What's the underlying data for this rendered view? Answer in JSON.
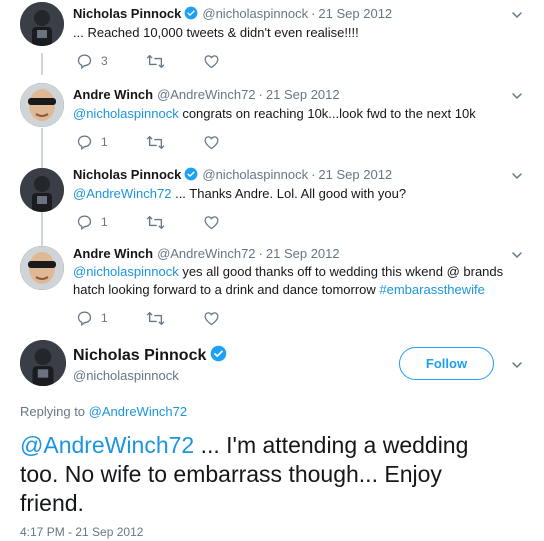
{
  "tweets": [
    {
      "name": "Nicholas Pinnock",
      "handle": "@nicholaspinnock",
      "date": "21 Sep 2012",
      "text": "... Reached 10,000 tweets & didn't even realise!!!!",
      "reply_count": "3",
      "retweet_count": "",
      "verified": true
    },
    {
      "name": "Andre Winch",
      "handle": "@AndreWinch72",
      "date": "21 Sep 2012",
      "mention": "@nicholaspinnock",
      "text": " congrats on reaching 10k...look fwd to the next 10k",
      "reply_count": "1",
      "verified": false
    },
    {
      "name": "Nicholas Pinnock",
      "handle": "@nicholaspinnock",
      "date": "21 Sep 2012",
      "mention": "@AndreWinch72",
      "text": " ... Thanks Andre. Lol. All good with you?",
      "reply_count": "1",
      "verified": true
    },
    {
      "name": "Andre Winch",
      "handle": "@AndreWinch72",
      "date": "21 Sep 2012",
      "mention": "@nicholaspinnock",
      "text_line1": " yes all good thanks off to wedding this wkend @ brands",
      "text_line2": "hatch looking forward to a drink and dance tomorrow ",
      "hashtag": "#embarassthewife",
      "reply_count": "1",
      "verified": false
    }
  ],
  "main_tweet": {
    "name": "Nicholas Pinnock",
    "handle": "@nicholaspinnock",
    "follow_label": "Follow",
    "replying_prefix": "Replying to ",
    "replying_to": "@AndreWinch72",
    "mention": "@AndreWinch72",
    "text_line1": " ... I'm attending a wedding",
    "text_line2": "too. No wife to embarrass though... Enjoy",
    "text_line3": "friend.",
    "timestamp": "4:17 PM - 21 Sep 2012"
  },
  "colors": {
    "link": "#1b95e0",
    "verified": "#1da1f2",
    "muted": "#657786",
    "thread_line": "#ccd6dd"
  },
  "icons": [
    "reply-icon",
    "retweet-icon",
    "like-icon",
    "chevron-down-icon",
    "verified-badge-icon"
  ]
}
